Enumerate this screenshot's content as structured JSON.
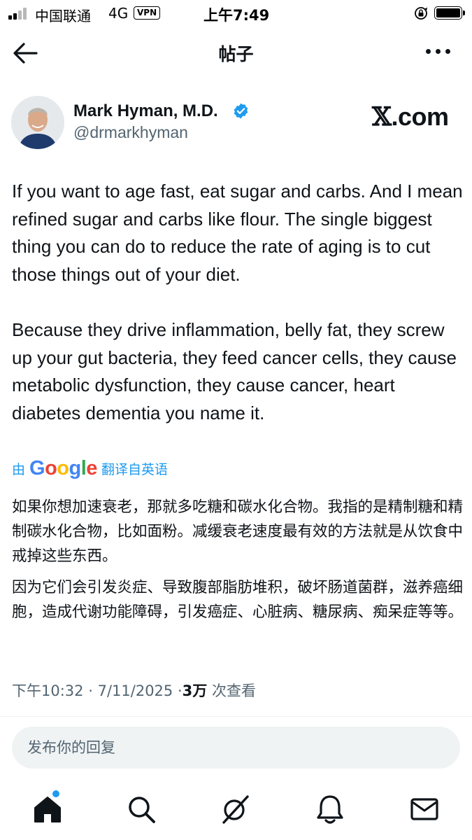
{
  "status_bar": {
    "carrier": "中国联通",
    "network": "4G",
    "vpn": "VPN",
    "time": "上午7:49"
  },
  "header": {
    "title": "帖子"
  },
  "author": {
    "name": "Mark Hyman, M.D.",
    "handle": "@drmarkhyman",
    "verified": true
  },
  "watermark": {
    "x_glyph": "𝕏",
    "text": ".com"
  },
  "tweet": {
    "paragraphs": [
      "If you want to age fast, eat sugar and carbs. And I mean refined sugar and carbs like flour. The single biggest thing you can do to reduce the rate of aging is to cut those things out of your diet.",
      "Because they drive inflammation, belly fat, they screw up your gut bacteria, they feed cancer cells, they cause metabolic dysfunction, they cause cancer, heart diabetes dementia you name it."
    ]
  },
  "translation": {
    "prefix": "由",
    "provider": "Google",
    "suffix": "翻译自英语",
    "paragraphs": [
      "如果你想加速衰老，那就多吃糖和碳水化合物。我指的是精制糖和精制碳水化合物，比如面粉。减缓衰老速度最有效的方法就是从饮食中戒掉这些东西。",
      "因为它们会引发炎症、导致腹部脂肪堆积，破坏肠道菌群，滋养癌细胞，造成代谢功能障碍，引发癌症、心脏病、糖尿病、痴呆症等等。"
    ]
  },
  "meta": {
    "time": "下午10:32",
    "date": "7/11/2025",
    "views_count": "3万",
    "views_label": "次查看",
    "separator": "·"
  },
  "reply": {
    "placeholder": "发布你的回复"
  },
  "nav": {
    "items": [
      "home-icon",
      "search-icon",
      "grok-icon",
      "notifications-icon",
      "messages-icon"
    ],
    "active": "home-icon",
    "home_has_dot": true
  },
  "colors": {
    "accent": "#1d9bf0",
    "text": "#0f1419",
    "secondary": "#536471",
    "google_blue": "#4285F4",
    "google_red": "#EA4335",
    "google_yellow": "#FBBC05",
    "google_green": "#34A853"
  }
}
